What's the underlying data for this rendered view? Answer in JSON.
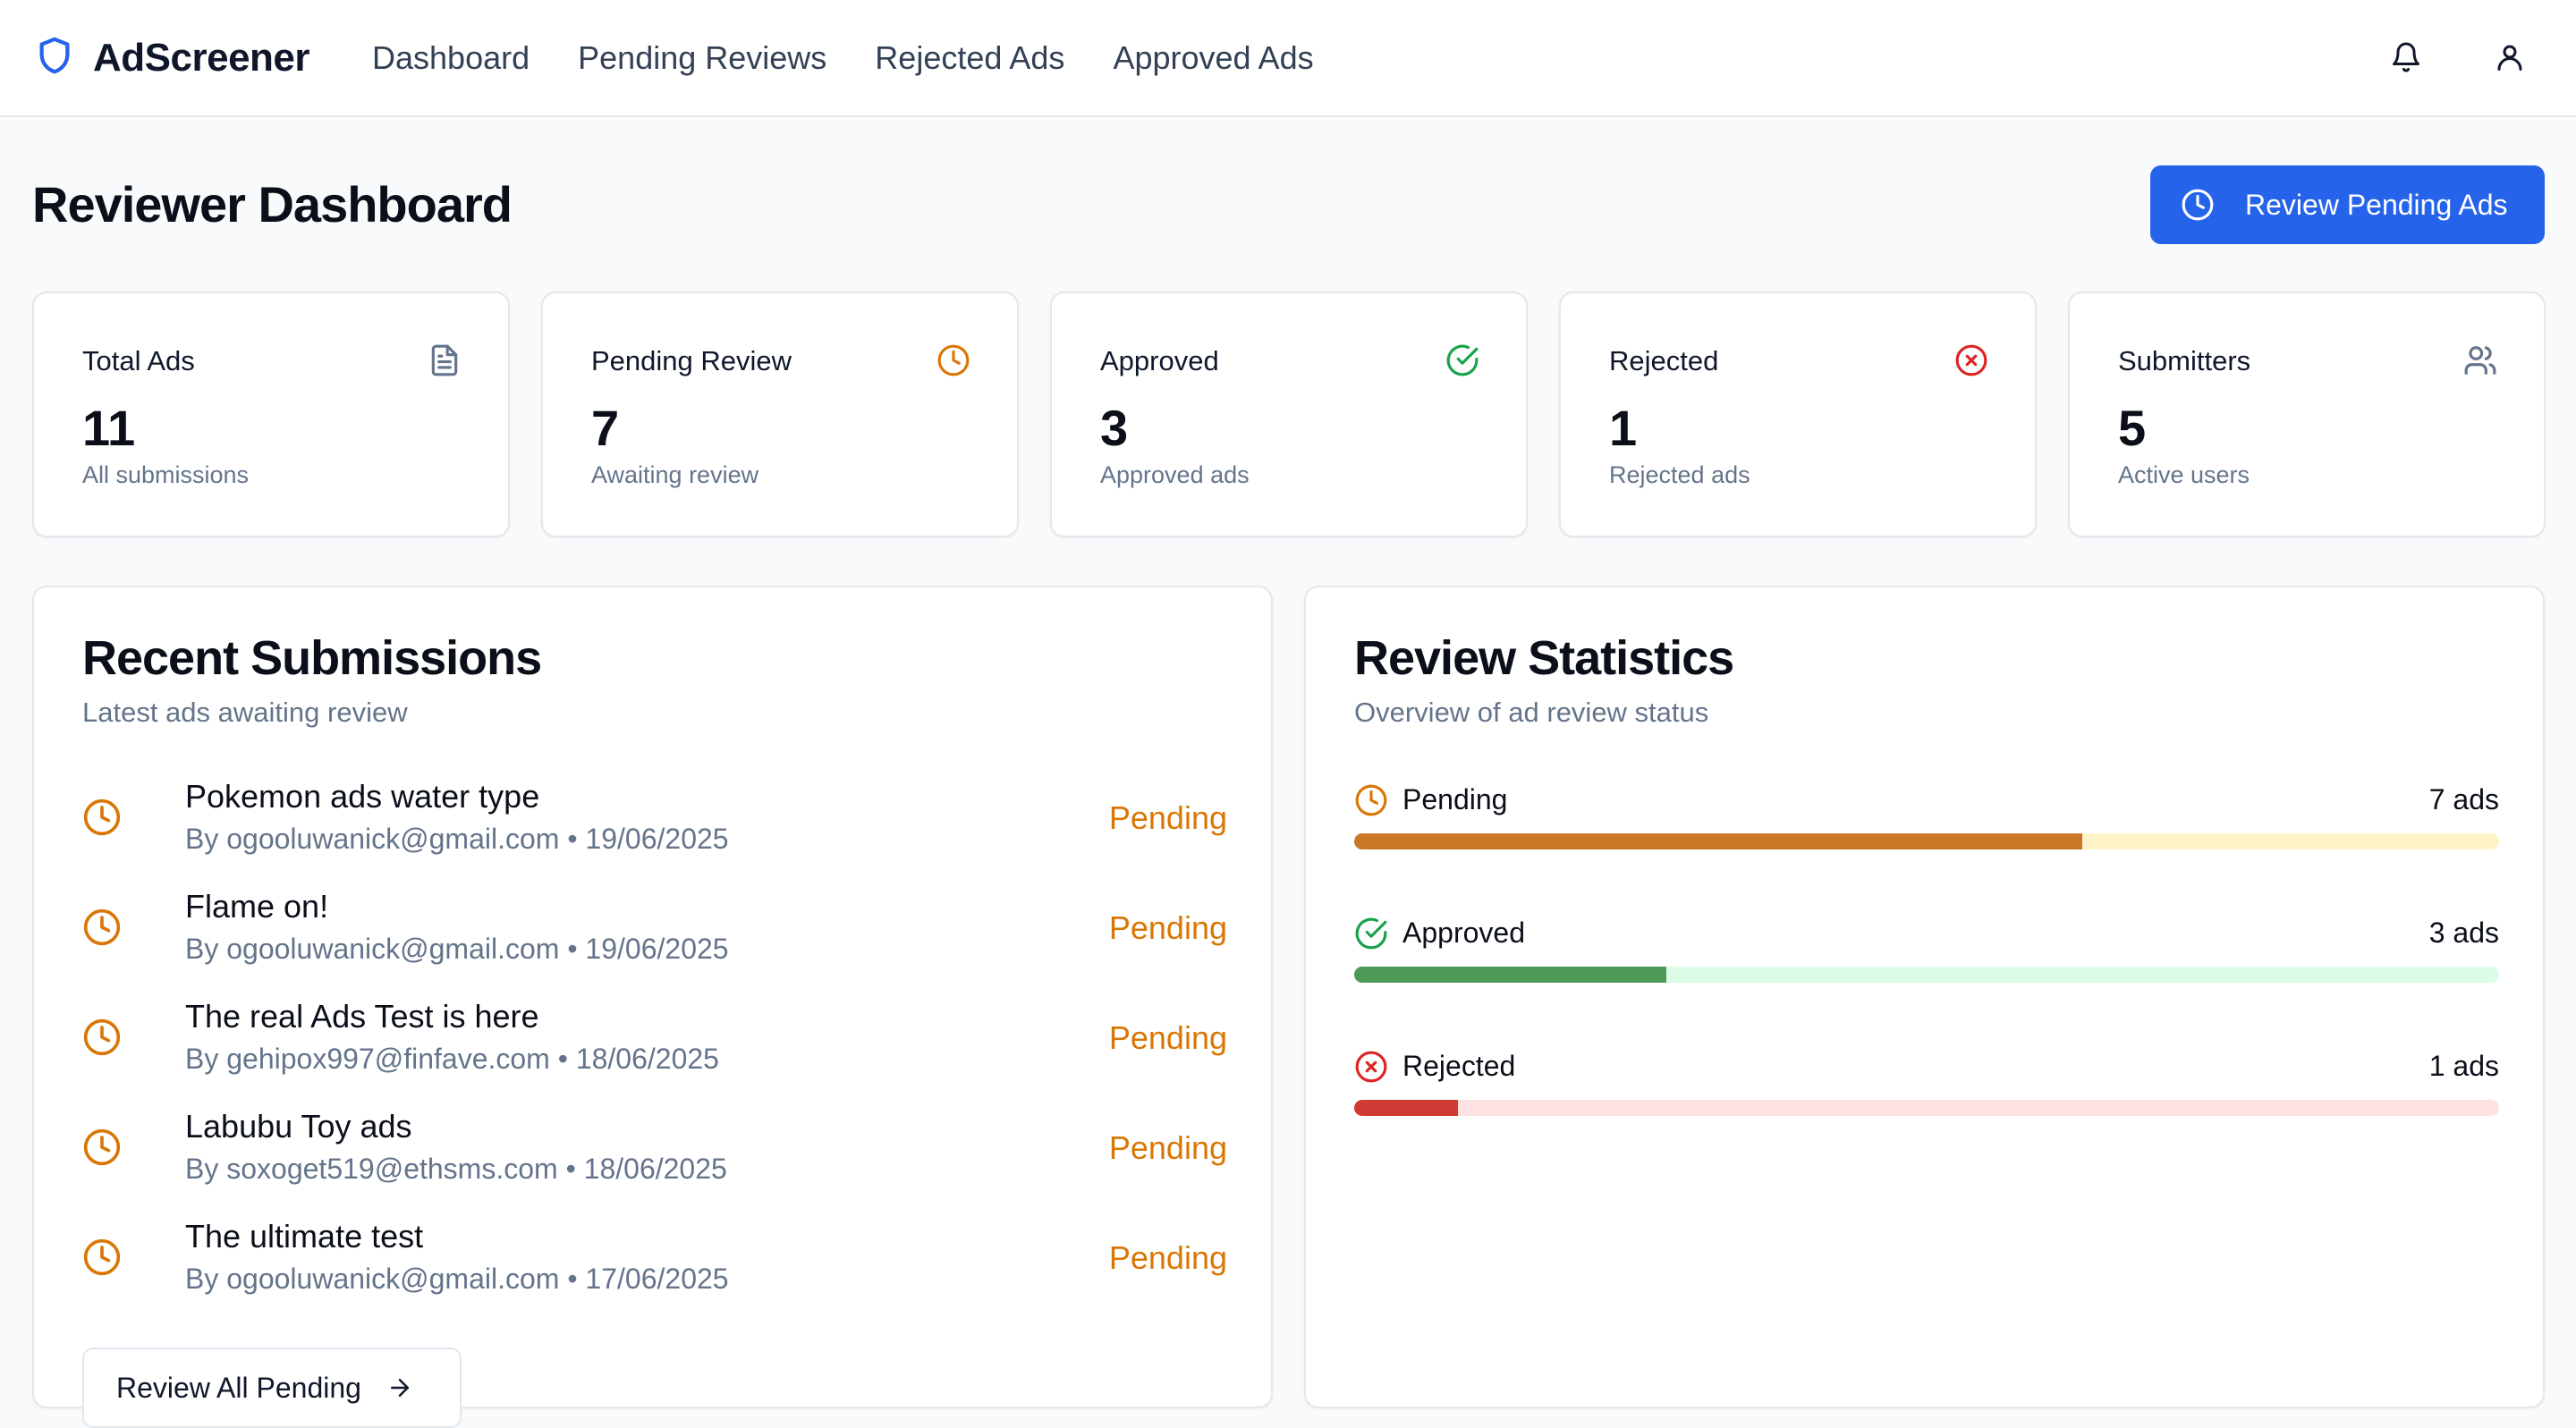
{
  "app": {
    "name": "AdScreener"
  },
  "nav": {
    "items": [
      {
        "label": "Dashboard"
      },
      {
        "label": "Pending Reviews"
      },
      {
        "label": "Rejected Ads"
      },
      {
        "label": "Approved Ads"
      }
    ],
    "icons": [
      "bell-icon",
      "user-icon"
    ]
  },
  "header": {
    "title": "Reviewer Dashboard",
    "primary_button": "Review Pending Ads"
  },
  "stats": [
    {
      "label": "Total Ads",
      "value": "11",
      "sub": "All submissions",
      "icon": "document-icon",
      "color": "#64748b"
    },
    {
      "label": "Pending Review",
      "value": "7",
      "sub": "Awaiting review",
      "icon": "clock-icon",
      "color": "#d97706"
    },
    {
      "label": "Approved",
      "value": "3",
      "sub": "Approved ads",
      "icon": "check-circle-icon",
      "color": "#16a34a"
    },
    {
      "label": "Rejected",
      "value": "1",
      "sub": "Rejected ads",
      "icon": "x-circle-icon",
      "color": "#dc2626"
    },
    {
      "label": "Submitters",
      "value": "5",
      "sub": "Active users",
      "icon": "users-icon",
      "color": "#64748b"
    }
  ],
  "recent": {
    "title": "Recent Submissions",
    "subtitle": "Latest ads awaiting review",
    "items": [
      {
        "title": "Pokemon ads water type",
        "meta": "By ogooluwanick@gmail.com • 19/06/2025",
        "status": "Pending"
      },
      {
        "title": "Flame on!",
        "meta": "By ogooluwanick@gmail.com • 19/06/2025",
        "status": "Pending"
      },
      {
        "title": "The real Ads Test is here",
        "meta": "By gehipox997@finfave.com • 18/06/2025",
        "status": "Pending"
      },
      {
        "title": "Labubu Toy ads",
        "meta": "By soxoget519@ethsms.com • 18/06/2025",
        "status": "Pending"
      },
      {
        "title": "The ultimate test",
        "meta": "By ogooluwanick@gmail.com • 17/06/2025",
        "status": "Pending"
      }
    ],
    "button": "Review All Pending"
  },
  "review_stats": {
    "title": "Review Statistics",
    "subtitle": "Overview of ad review status",
    "rows": [
      {
        "label": "Pending",
        "count": "7 ads",
        "fraction": 0.636,
        "color": "#d97706",
        "fill": "#c97828",
        "track": "#fef3c7"
      },
      {
        "label": "Approved",
        "count": "3 ads",
        "fraction": 0.273,
        "color": "#16a34a",
        "fill": "#4c9a55",
        "track": "#dcfce7"
      },
      {
        "label": "Rejected",
        "count": "1 ads",
        "fraction": 0.091,
        "color": "#dc2626",
        "fill": "#d03a35",
        "track": "#fee2e2"
      }
    ]
  }
}
